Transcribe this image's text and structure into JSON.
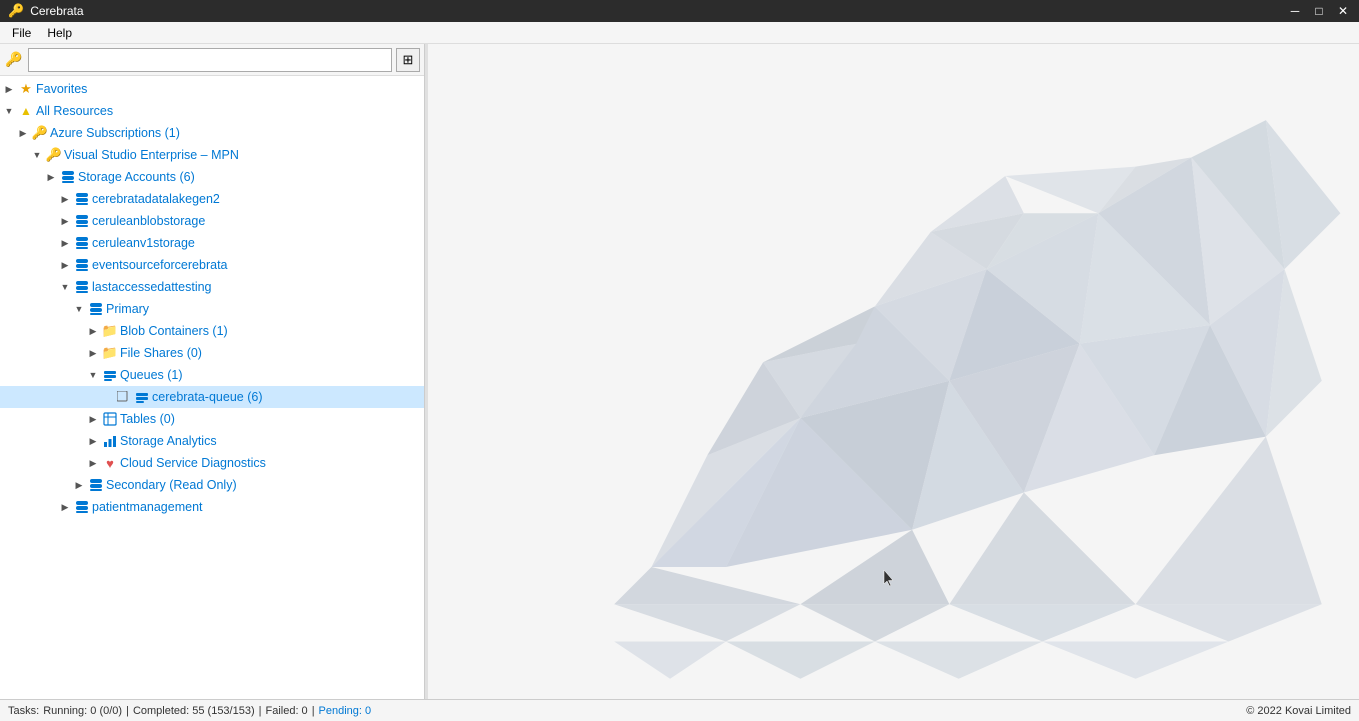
{
  "titleBar": {
    "appName": "Cerebrata",
    "minBtn": "─",
    "maxBtn": "□",
    "closeBtn": "✕"
  },
  "menuBar": {
    "items": [
      "File",
      "Help"
    ]
  },
  "sidebar": {
    "searchPlaceholder": "",
    "gridBtnLabel": "⊞",
    "tree": {
      "favorites": {
        "label": "Favorites"
      },
      "allResources": {
        "label": "All Resources"
      },
      "azureSubscriptions": {
        "label": "Azure Subscriptions (1)"
      },
      "visualStudio": {
        "label": "Visual Studio Enterprise – MPN"
      },
      "storageAccounts": {
        "label": "Storage Accounts (6)"
      },
      "cerebratadatalakegen2": {
        "label": "cerebratadatalakegen2"
      },
      "ceruleanblobstorage": {
        "label": "ceruleanblobstorage"
      },
      "ceruleanv1storage": {
        "label": "ceruleanv1storage"
      },
      "eventsourceforcerebrata": {
        "label": "eventsourceforcerebrata"
      },
      "lastaccessedattesting": {
        "label": "lastaccessedattesting"
      },
      "primary": {
        "label": "Primary"
      },
      "blobContainers": {
        "label": "Blob Containers (1)"
      },
      "fileShares": {
        "label": "File Shares (0)"
      },
      "queues": {
        "label": "Queues (1)"
      },
      "cerebrataQueue": {
        "label": "cerebrata-queue (6)"
      },
      "tables": {
        "label": "Tables (0)"
      },
      "storageAnalytics": {
        "label": "Storage Analytics"
      },
      "cloudServiceDiagnostics": {
        "label": "Cloud Service Diagnostics"
      },
      "secondary": {
        "label": "Secondary (Read Only)"
      },
      "patientmanagement": {
        "label": "patientmanagement"
      }
    }
  },
  "statusBar": {
    "tasksLabel": "Tasks:",
    "running": "Running: 0 (0/0)",
    "sep1": "|",
    "completed": "Completed: 55 (153/153)",
    "sep2": "|",
    "failed": "Failed: 0",
    "sep3": "|",
    "pending": "Pending: 0",
    "copyright": "© 2022 Kovai Limited"
  },
  "colors": {
    "selectedBg": "#cce8ff",
    "linkBlue": "#0078d4",
    "accentOrange": "#e8a000",
    "accentRed": "#e05050"
  }
}
